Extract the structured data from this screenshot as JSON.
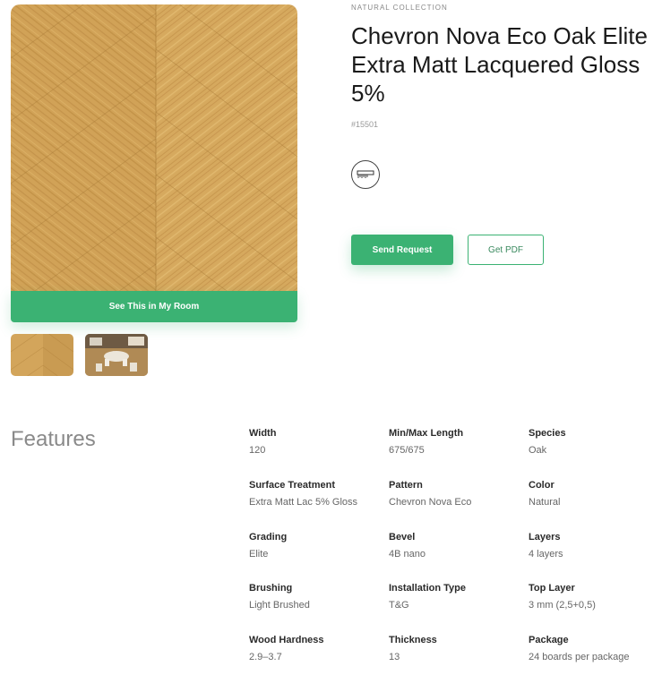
{
  "product": {
    "collection": "NATURAL COLLECTION",
    "title": "Chevron Nova Eco Oak Elite Extra Matt Lacquered Gloss 5%",
    "sku": "#15501",
    "icon": "saw-icon"
  },
  "buttons": {
    "see_in_room": "See This in My Room",
    "send_request": "Send Request",
    "get_pdf": "Get PDF"
  },
  "colors": {
    "accent": "#3bb273",
    "wood_light": "#d4a45a",
    "wood_dark": "#b98a3e"
  },
  "features": {
    "heading": "Features",
    "items": [
      {
        "label": "Width",
        "value": "120"
      },
      {
        "label": "Min/Max Length",
        "value": "675/675"
      },
      {
        "label": "Species",
        "value": "Oak"
      },
      {
        "label": "Surface Treatment",
        "value": "Extra Matt Lac 5% Gloss"
      },
      {
        "label": "Pattern",
        "value": "Chevron Nova Eco"
      },
      {
        "label": "Color",
        "value": "Natural"
      },
      {
        "label": "Grading",
        "value": "Elite"
      },
      {
        "label": "Bevel",
        "value": "4B nano"
      },
      {
        "label": "Layers",
        "value": "4 layers"
      },
      {
        "label": "Brushing",
        "value": "Light Brushed"
      },
      {
        "label": "Installation Type",
        "value": "T&G"
      },
      {
        "label": "Top Layer",
        "value": "3 mm (2,5+0,5)"
      },
      {
        "label": "Wood Hardness",
        "value": "2.9–3.7"
      },
      {
        "label": "Thickness",
        "value": "13"
      },
      {
        "label": "Package",
        "value": "24 boards per package"
      }
    ]
  }
}
